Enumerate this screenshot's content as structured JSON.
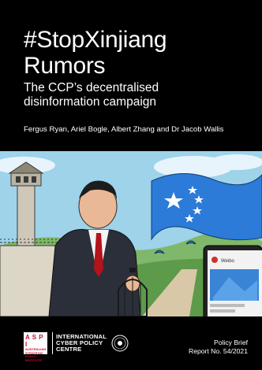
{
  "cover": {
    "title_line1": "#StopXinjiang",
    "title_line2": "Rumors",
    "subtitle_line1": "The CCP’s decentralised",
    "subtitle_line2": "disinformation campaign",
    "authors": "Fergus Ryan, Ariel Bogle, Albert Zhang and Dr Jacob Wallis"
  },
  "phone": {
    "app_label": "Weibo"
  },
  "footer": {
    "aspi_abbrev": "A S P I",
    "aspi_name_1": "AUSTRALIAN",
    "aspi_name_2": "STRATEGIC",
    "aspi_name_3": "POLICY",
    "aspi_name_4": "INSTITUTE",
    "icpc_line1": "INTERNATIONAL",
    "icpc_line2": "CYBER POLICY",
    "icpc_line3": "CENTRE",
    "report_type": "Policy Brief",
    "report_number": "Report No. 54/2021"
  }
}
